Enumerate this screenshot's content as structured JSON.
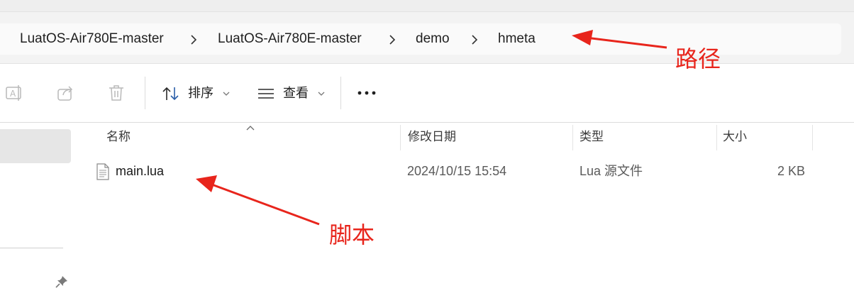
{
  "address_bar": {
    "breadcrumbs": [
      "LuatOS-Air780E-master",
      "LuatOS-Air780E-master",
      "demo",
      "hmeta"
    ]
  },
  "toolbar": {
    "rename_icon": "rename-icon",
    "share_icon": "share-icon",
    "delete_icon": "trash-icon",
    "sort_label": "排序",
    "view_label": "查看",
    "more_icon": "more-icon"
  },
  "columns": {
    "name": "名称",
    "modified": "修改日期",
    "type": "类型",
    "size": "大小"
  },
  "files": [
    {
      "name": "main.lua",
      "modified": "2024/10/15 15:54",
      "type": "Lua 源文件",
      "size": "2 KB"
    }
  ],
  "annotations": {
    "path_label": "路径",
    "script_label": "脚本",
    "color": "#e8251c"
  }
}
